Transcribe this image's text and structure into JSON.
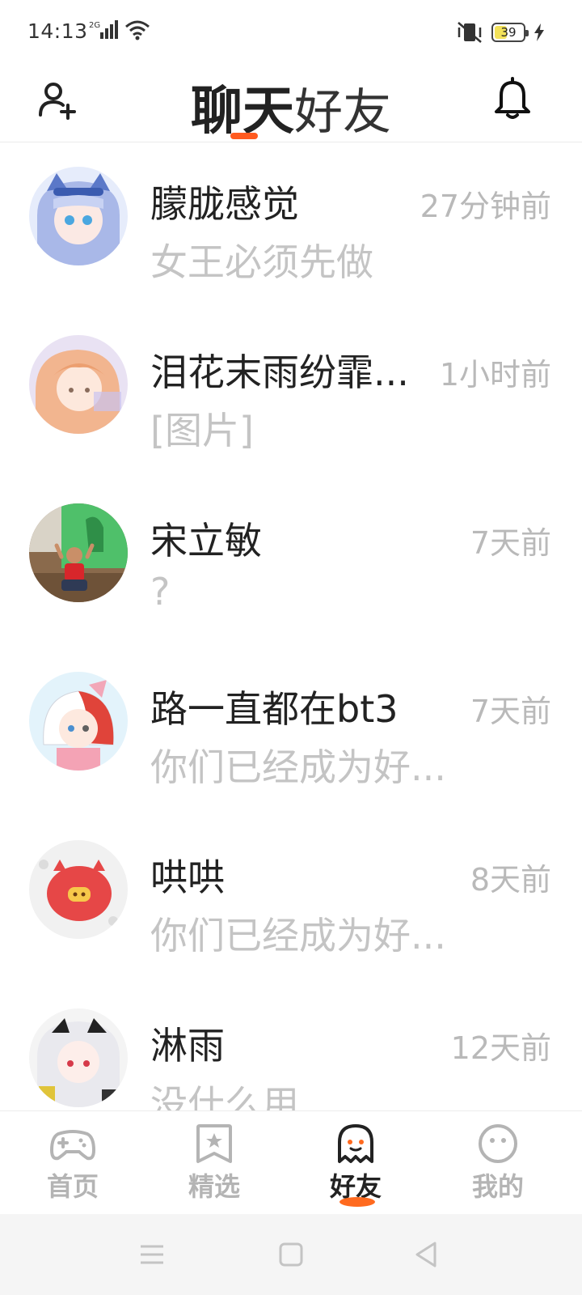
{
  "status_bar": {
    "time": "14:13",
    "network": "2G",
    "battery": "39",
    "battery_level": 0.39
  },
  "header": {
    "tab_active": "聊天",
    "tab_inactive": "好友",
    "accent_color": "#ff5a1f"
  },
  "chats": [
    {
      "name": "朦胧感觉",
      "time": "27分钟前",
      "message": "女王必须先做",
      "avatar": "anime-girl-blue-hair"
    },
    {
      "name": "泪花末雨纷霏...",
      "time": "1小时前",
      "message": "[图片]",
      "avatar": "anime-character-orange"
    },
    {
      "name": "宋立敏",
      "time": "7天前",
      "message": "?",
      "avatar": "child-photo"
    },
    {
      "name": "路一直都在bt3",
      "time": "7天前",
      "message": "你们已经成为好...",
      "avatar": "anime-boy-red-white-hair"
    },
    {
      "name": "哄哄",
      "time": "8天前",
      "message": "你们已经成为好...",
      "avatar": "red-pig-cartoon"
    },
    {
      "name": "淋雨",
      "time": "12天前",
      "message": "没什么用",
      "avatar": "anime-girl-white-hair"
    }
  ],
  "bottom_nav": {
    "items": [
      {
        "label": "首页",
        "icon": "gamepad-icon"
      },
      {
        "label": "精选",
        "icon": "star-bookmark-icon"
      },
      {
        "label": "好友",
        "icon": "ghost-icon"
      },
      {
        "label": "我的",
        "icon": "smiley-icon"
      }
    ],
    "active_index": 2
  }
}
